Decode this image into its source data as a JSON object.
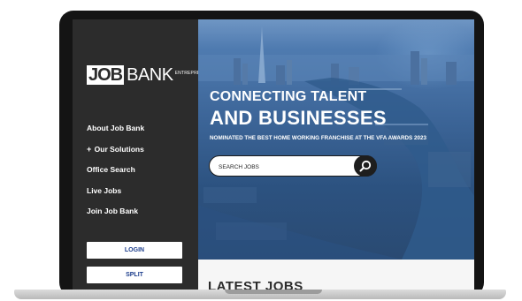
{
  "sidebar": {
    "logo": {
      "job": "JOB",
      "bank": "BANK",
      "tag": "ENTREPRENEUR"
    },
    "nav": [
      {
        "label": "About Job Bank"
      },
      {
        "prefix": "+",
        "label": "Our Solutions"
      },
      {
        "label": "Office Search"
      },
      {
        "label": "Live Jobs"
      },
      {
        "label": "Join Job Bank"
      }
    ],
    "login_label": "LOGIN",
    "split_label": "SPLIT"
  },
  "hero": {
    "title_line1": "CONNECTING TALENT",
    "title_line2": "AND BUSINESSES",
    "subtitle": "NOMINATED THE BEST HOME WORKING FRANCHISE AT THE VFA AWARDS 2023",
    "search": {
      "placeholder": "SEARCH JOBS",
      "icon": "search-icon"
    }
  },
  "latest": {
    "title": "LATEST JOBS"
  },
  "colors": {
    "sidebar_bg": "#2c2c2c",
    "button_text": "#1c3d8c",
    "hero_blue": "#3d6699",
    "frame": "#141414"
  }
}
